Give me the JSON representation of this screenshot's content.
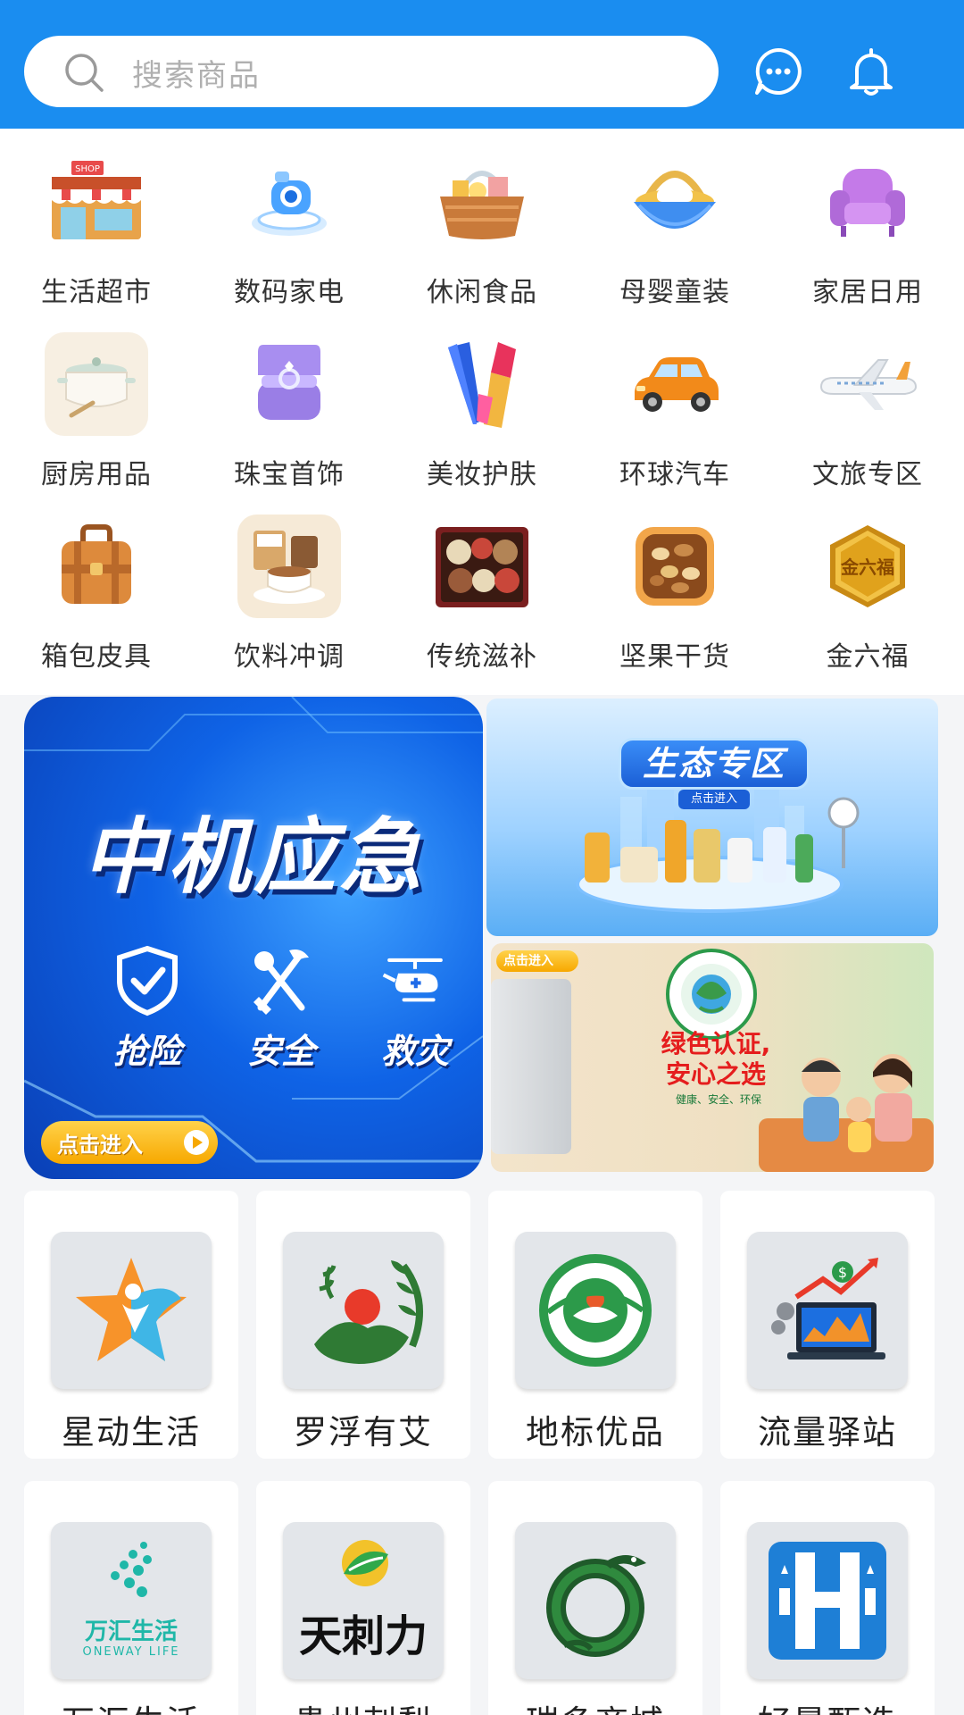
{
  "search": {
    "placeholder": "搜索商品",
    "icon": "search-icon"
  },
  "header_icons": [
    "message-icon",
    "bell-icon"
  ],
  "categories": [
    {
      "label": "生活超市",
      "icon": "shop-icon"
    },
    {
      "label": "数码家电",
      "icon": "camera-device-icon"
    },
    {
      "label": "休闲食品",
      "icon": "snack-basket-icon"
    },
    {
      "label": "母婴童装",
      "icon": "baby-crib-icon"
    },
    {
      "label": "家居日用",
      "icon": "sofa-icon"
    },
    {
      "label": "厨房用品",
      "icon": "cooking-pot-icon"
    },
    {
      "label": "珠宝首饰",
      "icon": "ring-box-icon"
    },
    {
      "label": "美妆护肤",
      "icon": "lipstick-icon"
    },
    {
      "label": "环球汽车",
      "icon": "car-icon"
    },
    {
      "label": "文旅专区",
      "icon": "airplane-icon"
    },
    {
      "label": "箱包皮具",
      "icon": "suitcase-icon"
    },
    {
      "label": "饮料冲调",
      "icon": "coffee-icon"
    },
    {
      "label": "传统滋补",
      "icon": "tonic-box-icon"
    },
    {
      "label": "坚果干货",
      "icon": "nuts-icon"
    },
    {
      "label": "金六福",
      "icon": "gold-badge-icon"
    }
  ],
  "banner_emergency": {
    "title": "中机应急",
    "features": [
      {
        "label": "抢险",
        "icon": "shield-check-icon"
      },
      {
        "label": "安全",
        "icon": "tools-icon"
      },
      {
        "label": "救灾",
        "icon": "helicopter-icon"
      }
    ],
    "enter": "点击进入"
  },
  "banner_eco": {
    "title": "生态专区",
    "enter": "点击进入"
  },
  "banner_green": {
    "enter": "点击进入",
    "title_line1": "绿色认证,",
    "title_line2": "安心之选",
    "subtitle": "健康、安全、环保"
  },
  "stores": [
    {
      "name": "星动生活"
    },
    {
      "name": "罗浮有艾"
    },
    {
      "name": "地标优品"
    },
    {
      "name": "流量驿站"
    },
    {
      "name": "万汇生活",
      "logo_text": "万汇生活",
      "logo_sub": "ONEWAY LIFE"
    },
    {
      "name": "贵州刺梨",
      "logo_text": "天刺力"
    },
    {
      "name": "瑞多商城"
    },
    {
      "name": "好景甄选"
    }
  ],
  "colors": {
    "header": "#1a8df0",
    "accent_orange": "#f7a800",
    "green": "#2c9a4a"
  }
}
